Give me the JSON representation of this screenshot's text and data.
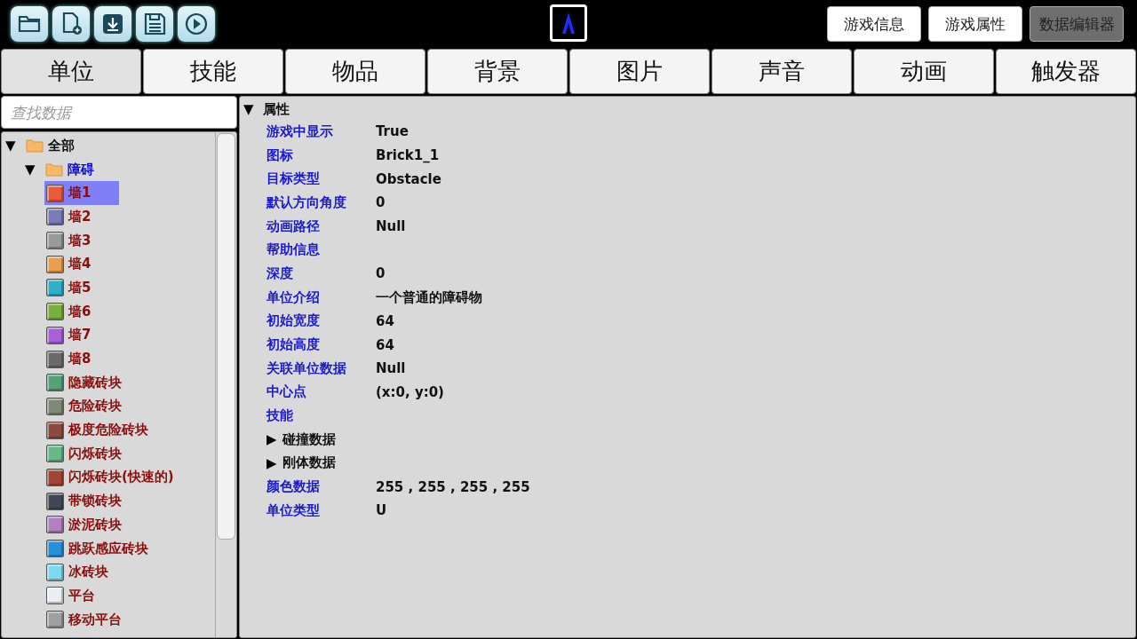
{
  "toolbar": {
    "tools": [
      {
        "kind": "open"
      },
      {
        "kind": "new"
      },
      {
        "kind": "download"
      },
      {
        "kind": "save"
      },
      {
        "kind": "play"
      }
    ],
    "buttons": [
      {
        "label": "游戏信息",
        "selected": false
      },
      {
        "label": "游戏属性",
        "selected": false
      },
      {
        "label": "数据编辑器",
        "selected": true
      }
    ]
  },
  "tabs": [
    {
      "label": "单位",
      "selected": true
    },
    {
      "label": "技能",
      "selected": false
    },
    {
      "label": "物品",
      "selected": false
    },
    {
      "label": "背景",
      "selected": false
    },
    {
      "label": "图片",
      "selected": false
    },
    {
      "label": "声音",
      "selected": false
    },
    {
      "label": "动画",
      "selected": false
    },
    {
      "label": "触发器",
      "selected": false
    }
  ],
  "search": {
    "placeholder": "查找数据"
  },
  "tree": [
    {
      "label": "全部",
      "toggle": "▼",
      "children": [
        {
          "label": "障碍",
          "toggle": "▼",
          "children": [
            {
              "label": "墙1",
              "color": "#e85a3a",
              "selected": true
            },
            {
              "label": "墙2",
              "color": "#7a7ab8",
              "selected": false
            },
            {
              "label": "墙3",
              "color": "#9a9a9a",
              "selected": false
            },
            {
              "label": "墙4",
              "color": "#e8a050",
              "selected": false
            },
            {
              "label": "墙5",
              "color": "#30b0c8",
              "selected": false
            },
            {
              "label": "墙6",
              "color": "#78b040",
              "selected": false
            },
            {
              "label": "墙7",
              "color": "#a860d8",
              "selected": false
            },
            {
              "label": "墙8",
              "color": "#6a6a6a",
              "selected": false
            },
            {
              "label": "隐藏砖块",
              "color": "#58a078",
              "selected": false
            },
            {
              "label": "危险砖块",
              "color": "#808878",
              "selected": false
            },
            {
              "label": "极度危险砖块",
              "color": "#8a4a40",
              "selected": false
            },
            {
              "label": "闪烁砖块",
              "color": "#68b888",
              "selected": false
            },
            {
              "label": "闪烁砖块(快速的)",
              "color": "#a04438",
              "selected": false
            },
            {
              "label": "带锁砖块",
              "color": "#404858",
              "selected": false
            },
            {
              "label": "淤泥砖块",
              "color": "#b080c0",
              "selected": false
            },
            {
              "label": "跳跃感应砖块",
              "color": "#2890d8",
              "selected": false
            },
            {
              "label": "冰砖块",
              "color": "#80d8f0",
              "selected": false
            },
            {
              "label": "平台",
              "color": "#e8eef4",
              "selected": false
            },
            {
              "label": "移动平台",
              "color": "#a0a0a0",
              "selected": false
            }
          ]
        }
      ]
    }
  ],
  "properties": {
    "toggle": "▼",
    "title": "属性",
    "rows": [
      {
        "kind": "field",
        "name": "游戏中显示",
        "value": "True"
      },
      {
        "kind": "field",
        "name": "图标",
        "value": "Brick1_1"
      },
      {
        "kind": "field",
        "name": "目标类型",
        "value": "Obstacle"
      },
      {
        "kind": "field",
        "name": "默认方向角度",
        "value": "0"
      },
      {
        "kind": "field",
        "name": "动画路径",
        "value": "Null"
      },
      {
        "kind": "field",
        "name": "帮助信息"
      },
      {
        "kind": "field",
        "name": "深度",
        "value": "0"
      },
      {
        "kind": "field",
        "name": "单位介绍",
        "value": "一个普通的障碍物"
      },
      {
        "kind": "field",
        "name": "初始宽度",
        "value": "64"
      },
      {
        "kind": "field",
        "name": "初始高度",
        "value": "64"
      },
      {
        "kind": "field",
        "name": "关联单位数据",
        "value": "Null"
      },
      {
        "kind": "field",
        "name": "中心点",
        "value": "(x:0, y:0)"
      },
      {
        "kind": "field",
        "name": "技能"
      },
      {
        "kind": "group",
        "toggle": "▶",
        "name": "碰撞数据"
      },
      {
        "kind": "group",
        "toggle": "▶",
        "name": "刚体数据"
      },
      {
        "kind": "field",
        "name": "颜色数据",
        "value": "255 , 255 , 255 , 255"
      },
      {
        "kind": "field",
        "name": "单位类型",
        "value": "U"
      }
    ]
  }
}
